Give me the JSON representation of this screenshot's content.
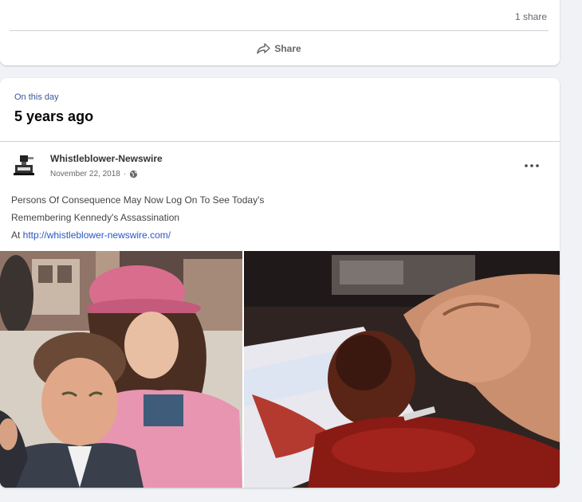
{
  "previous_post": {
    "share_count": "1 share",
    "share_label": "Share",
    "share_icon": "share-arrow-icon"
  },
  "memory": {
    "kicker": "On this day",
    "title": "5 years ago"
  },
  "post": {
    "author": "Whistleblower-Newswire",
    "date": "November 22, 2018",
    "date_separator": "·",
    "audience_icon": "globe-icon",
    "more_icon": "more-options-icon",
    "text_lines": [
      "Persons Of Consequence May Now Log On To See Today's",
      "Remembering Kennedy's Assassination"
    ],
    "link_prefix": "At ",
    "link": "http://whistleblower-newswire.com/"
  },
  "colors": {
    "page_background": "#f0f2f5",
    "card_background": "#ffffff",
    "link": "#2a55c4",
    "secondary_text": "#65676b"
  }
}
